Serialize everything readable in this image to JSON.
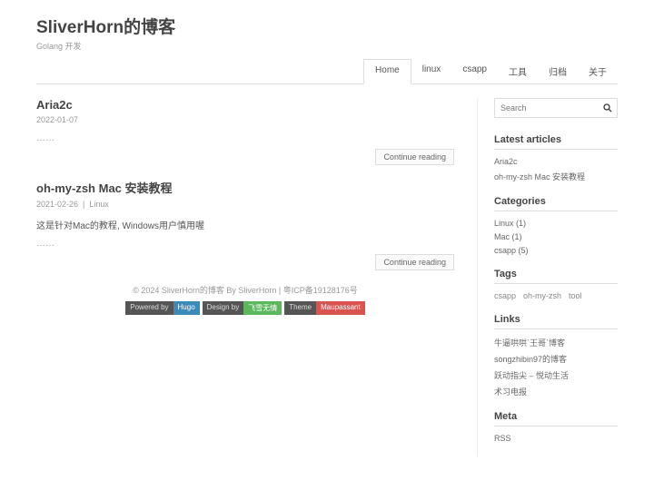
{
  "header": {
    "title": "SliverHorn的博客",
    "tagline": "Golang 开发"
  },
  "nav": [
    {
      "label": "Home",
      "active": true
    },
    {
      "label": "linux"
    },
    {
      "label": "csapp"
    },
    {
      "label": "工具"
    },
    {
      "label": "归档"
    },
    {
      "label": "关于"
    }
  ],
  "articles": [
    {
      "title": "Aria2c",
      "date": "2022-01-07",
      "category": "",
      "excerpt": "",
      "more": "……",
      "readmore": "Continue reading"
    },
    {
      "title": "oh-my-zsh Mac 安装教程",
      "date": "2021-02-26",
      "category": "Linux",
      "excerpt": "这是针对Mac的教程, Windows用户慎用喔",
      "more": "……",
      "readmore": "Continue reading"
    }
  ],
  "footer": {
    "copyright": "© 2024 SliverHorn的博客 By SliverHorn | 粤ICP备19128176号",
    "badges": [
      {
        "label": "Powered by",
        "value": "Hugo",
        "cls": "hugo"
      },
      {
        "label": "Design by",
        "value": "飞雪无情",
        "cls": "design"
      },
      {
        "label": "Theme",
        "value": "Maupassant",
        "cls": "theme"
      }
    ]
  },
  "sidebar": {
    "search_placeholder": "Search",
    "widgets": {
      "latest": {
        "title": "Latest articles",
        "items": [
          "Aria2c",
          "oh-my-zsh Mac 安装教程"
        ]
      },
      "categories": {
        "title": "Categories",
        "items": [
          "Linux (1)",
          "Mac (1)",
          "csapp (5)"
        ]
      },
      "tags": {
        "title": "Tags",
        "items": [
          "csapp",
          "oh-my-zsh",
          "tool"
        ]
      },
      "links": {
        "title": "Links",
        "items": [
          "牛逼哄哄`王哥`博客",
          "songzhibin97的博客",
          "跃动指尖 – 悦动生活",
          "术习电报"
        ]
      },
      "meta": {
        "title": "Meta",
        "items": [
          "RSS"
        ]
      }
    }
  }
}
